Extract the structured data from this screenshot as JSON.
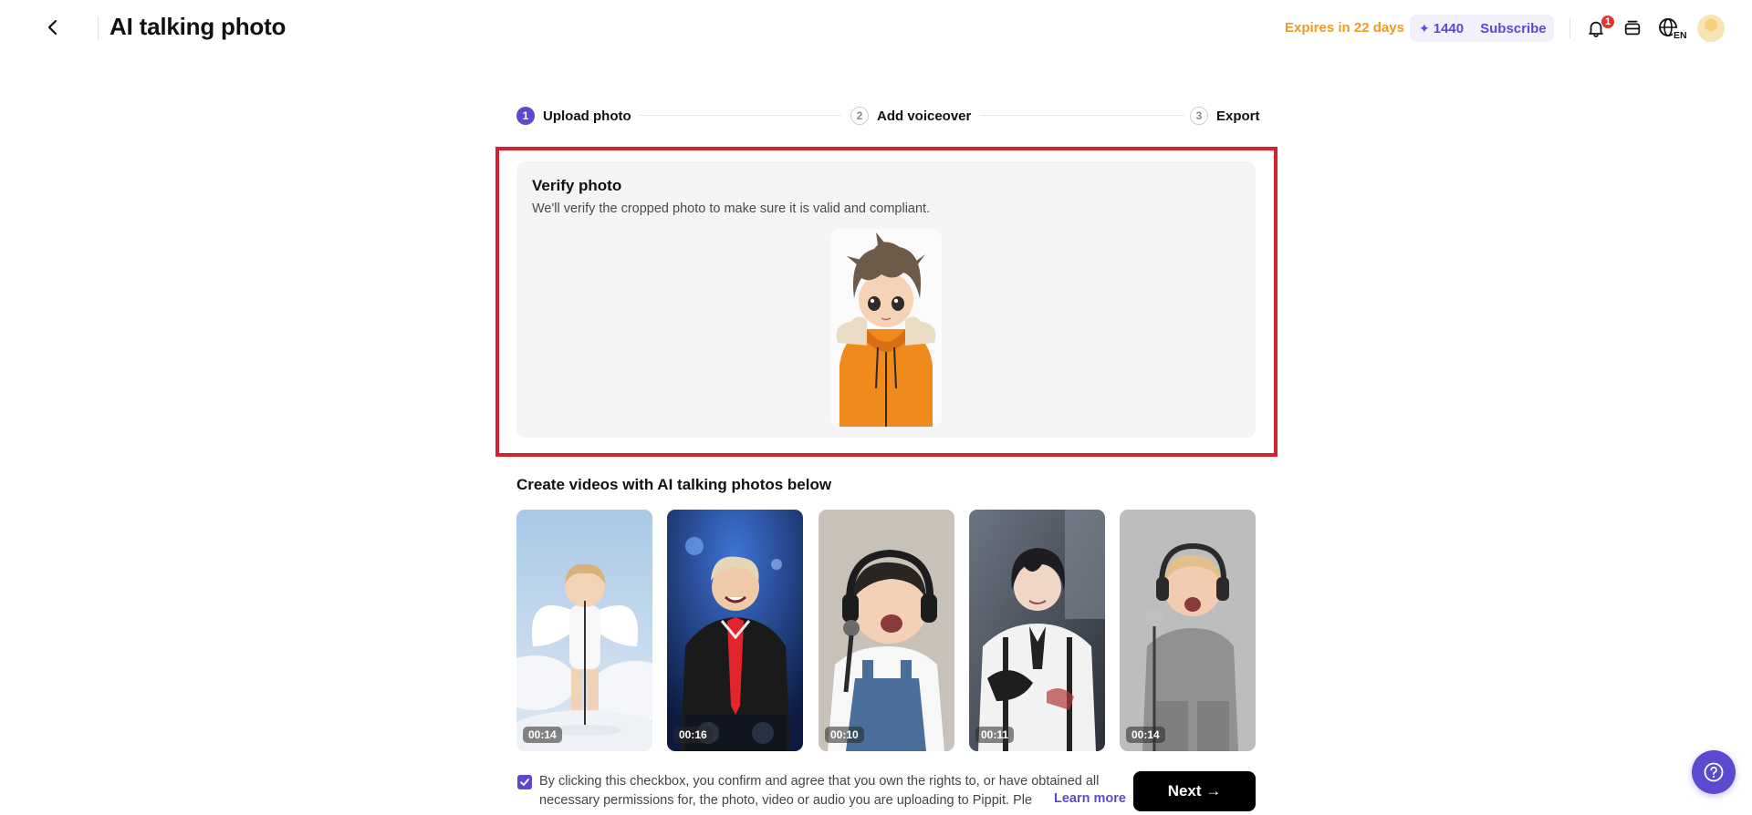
{
  "header": {
    "title": "AI talking photo",
    "expires": "Expires in 22 days",
    "credits": "1440",
    "subscribe": "Subscribe",
    "notification_count": "1",
    "language": "EN",
    "icons": [
      "back-icon",
      "bell-icon",
      "stack-icon",
      "globe-icon",
      "avatar"
    ]
  },
  "stepper": {
    "steps": [
      {
        "num": "1",
        "label": "Upload photo",
        "state": "active"
      },
      {
        "num": "2",
        "label": "Add voiceover",
        "state": "inactive"
      },
      {
        "num": "3",
        "label": "Export",
        "state": "inactive"
      }
    ]
  },
  "verify": {
    "title": "Verify photo",
    "description": "We'll verify the cropped photo to make sure it is valid and compliant."
  },
  "examples": {
    "heading": "Create videos with AI talking photos below",
    "items": [
      {
        "duration": "00:14"
      },
      {
        "duration": "00:16"
      },
      {
        "duration": "00:10"
      },
      {
        "duration": "00:11"
      },
      {
        "duration": "00:14"
      }
    ]
  },
  "footer": {
    "consent_text": "By clicking this checkbox, you confirm and agree that you own the rights to, or have obtained all necessary permissions for, the photo, video or audio you are uploading to Pippit. Ple",
    "learn_more": "Learn more",
    "next_label": "Next →",
    "checked": true
  },
  "colors": {
    "accent": "#5b4ad0",
    "warning": "#f39a1e",
    "highlight": "#d4202f"
  }
}
